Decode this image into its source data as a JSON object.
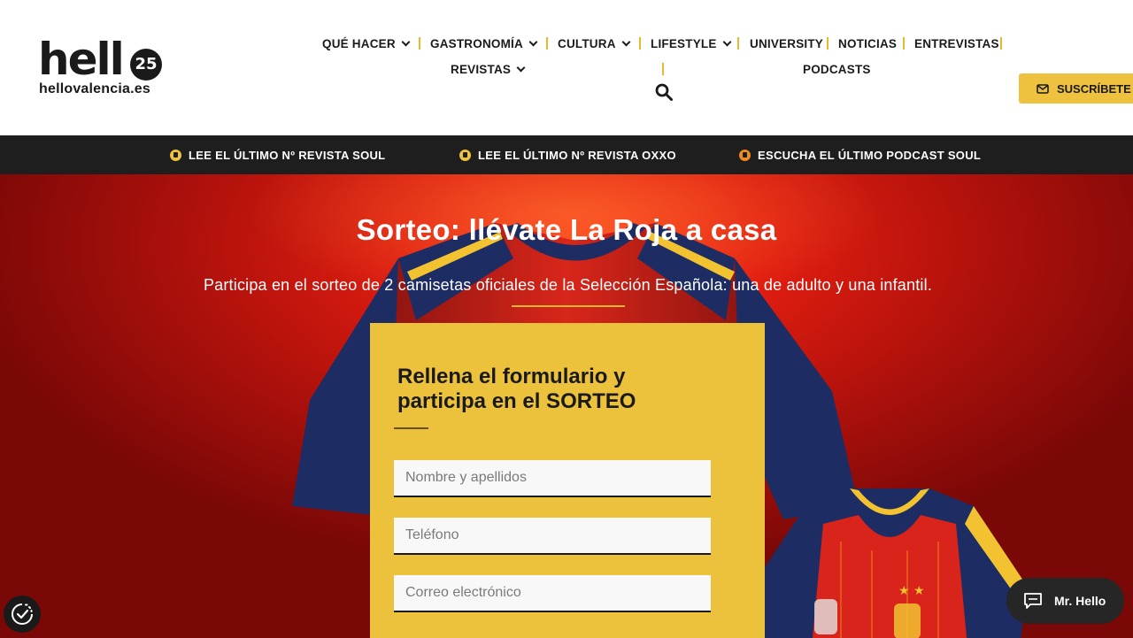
{
  "header": {
    "logo": {
      "word": "hell",
      "badge": "25",
      "domain": "hellovalencia.es"
    },
    "nav": [
      {
        "label": "QUÉ HACER",
        "has_dropdown": true
      },
      {
        "label": "GASTRONOMÍA",
        "has_dropdown": true
      },
      {
        "label": "CULTURA",
        "has_dropdown": true
      },
      {
        "label": "LIFESTYLE",
        "has_dropdown": true
      },
      {
        "label": "UNIVERSITY",
        "has_dropdown": false
      },
      {
        "label": "NOTICIAS",
        "has_dropdown": false
      },
      {
        "label": "ENTREVISTAS",
        "has_dropdown": false
      },
      {
        "label": "REVISTAS",
        "has_dropdown": true
      },
      {
        "label": "PODCASTS",
        "has_dropdown": false
      }
    ],
    "search_icon": "search-icon",
    "subscribe_label": "SUSCRÍBETE"
  },
  "topbar": {
    "links": [
      {
        "label": "LEE EL ÚLTIMO Nº REVISTA SOUL",
        "icon": "download-icon"
      },
      {
        "label": "LEE EL ÚLTIMO Nº REVISTA OXXO",
        "icon": "download-icon"
      },
      {
        "label": "ESCUCHA EL ÚLTIMO PODCAST SOUL",
        "icon": "podcast-icon"
      }
    ]
  },
  "hero": {
    "title": "Sorteo: llévate La Roja a casa",
    "subtitle": "Participa en el sorteo de 2 camisetas oficiales de la Selección Española: una de adulto y una infantil."
  },
  "form": {
    "title": "Rellena el formulario y participa en el SORTEO",
    "fields": [
      {
        "placeholder": "Nombre y apellidos"
      },
      {
        "placeholder": "Teléfono"
      },
      {
        "placeholder": "Correo electrónico"
      }
    ]
  },
  "widgets": {
    "chat_label": "Mr. Hello"
  },
  "colors": {
    "accent": "#eec23f",
    "dark": "#1e1e1e",
    "hero_red": "#d41a10",
    "navy": "#1d2d63"
  }
}
